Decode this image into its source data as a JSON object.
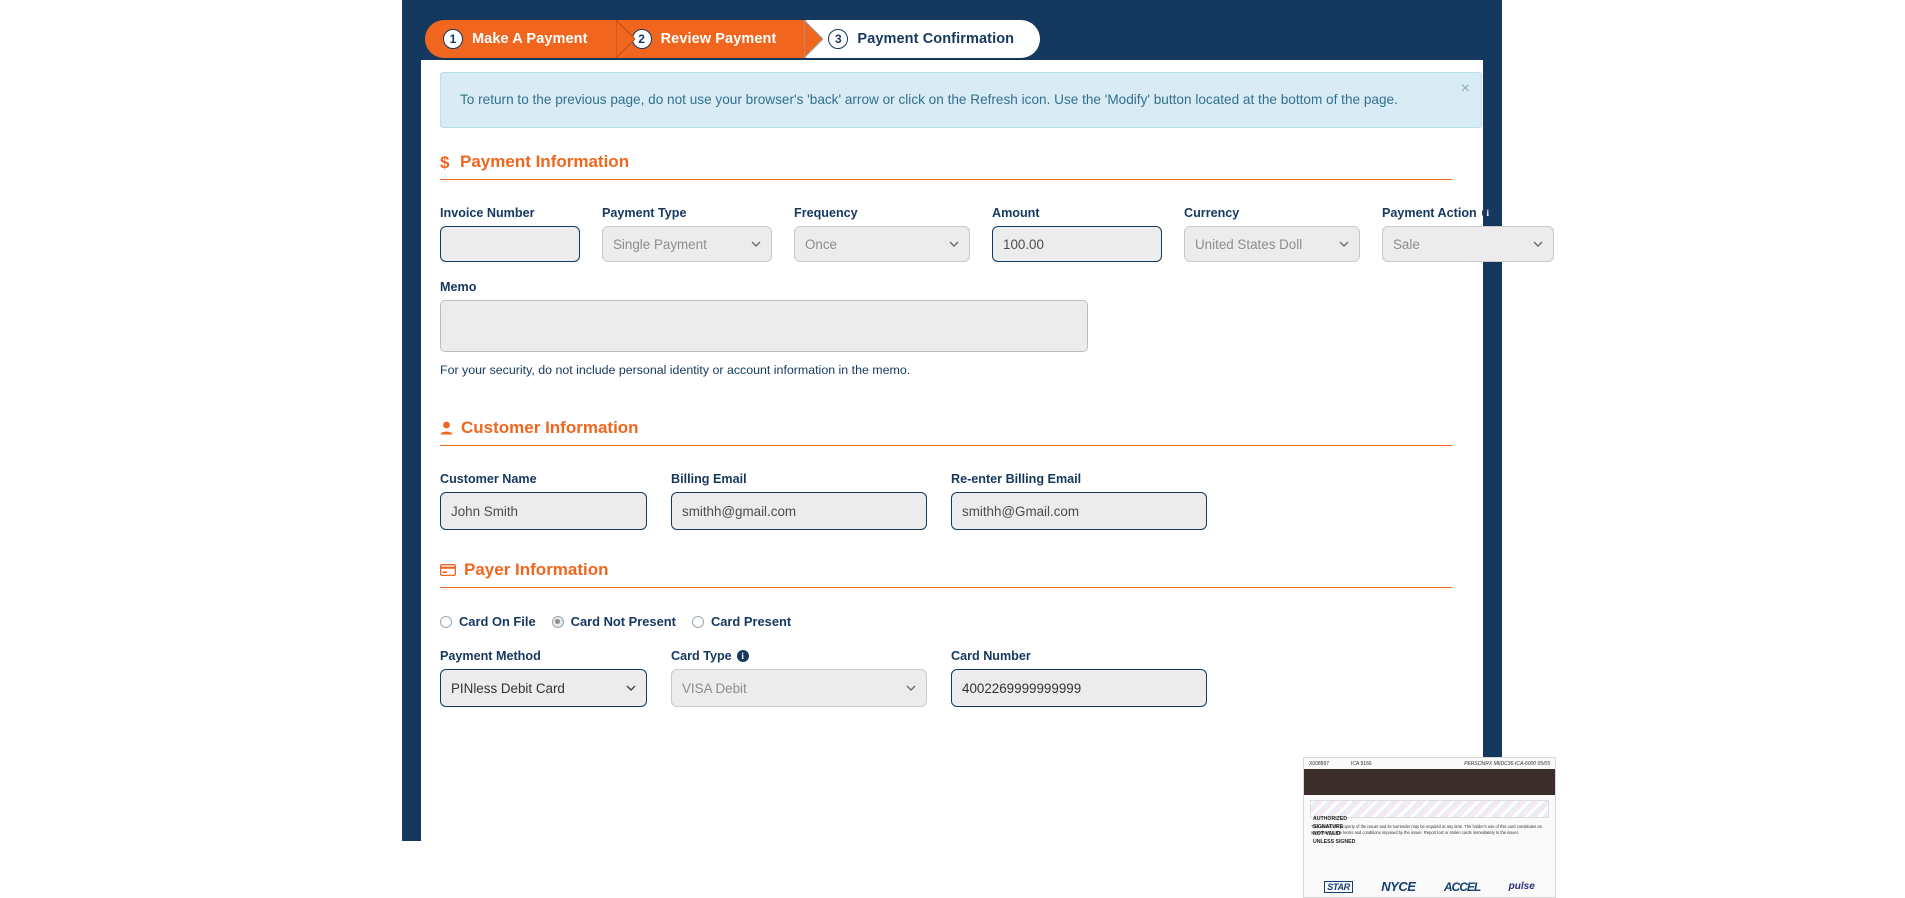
{
  "wizard": {
    "steps": [
      {
        "number": "1",
        "label": "Make A Payment",
        "state": "done"
      },
      {
        "number": "2",
        "label": "Review Payment",
        "state": "active"
      },
      {
        "number": "3",
        "label": "Payment Confirmation",
        "state": "todo"
      }
    ]
  },
  "alert": {
    "message": "To return to the previous page, do not use your browser's 'back' arrow or click on the Refresh icon. Use the 'Modify' button located at the bottom of the page.",
    "close_label": "×"
  },
  "payment_information": {
    "heading": "Payment Information",
    "heading_icon": "dollar-icon",
    "invoice_number": {
      "label": "Invoice Number",
      "value": ""
    },
    "payment_type": {
      "label": "Payment Type",
      "value": "Single Payment"
    },
    "frequency": {
      "label": "Frequency",
      "value": "Once"
    },
    "amount": {
      "label": "Amount",
      "value": "100.00"
    },
    "currency": {
      "label": "Currency",
      "value": "United States Doll"
    },
    "payment_action": {
      "label": "Payment Action",
      "value": "Sale",
      "info_icon": "info-icon"
    },
    "memo": {
      "label": "Memo",
      "value": "",
      "note": "For your security, do not include personal identity or account information in the memo."
    }
  },
  "customer_information": {
    "heading": "Customer Information",
    "heading_icon": "user-icon",
    "customer_name": {
      "label": "Customer Name",
      "value": "John Smith"
    },
    "billing_email": {
      "label": "Billing Email",
      "value": "smithh@gmail.com"
    },
    "reenter_billing_email": {
      "label": "Re-enter Billing Email",
      "value": "smithh@Gmail.com"
    }
  },
  "payer_information": {
    "heading": "Payer Information",
    "heading_icon": "credit-card-icon",
    "card_presence_options": [
      {
        "label": "Card On File",
        "selected": false
      },
      {
        "label": "Card Not Present",
        "selected": true
      },
      {
        "label": "Card Present",
        "selected": false
      }
    ],
    "payment_method": {
      "label": "Payment Method",
      "value": "PINless Debit Card"
    },
    "card_type": {
      "label": "Card Type",
      "value": "VISA Debit",
      "info_icon": "info-icon"
    },
    "card_number": {
      "label": "Card Number",
      "value": "4002269999999999"
    }
  },
  "card_image": {
    "top_left_code": "X008897",
    "top_mid_code": "ICA 9166",
    "top_right_code": "PERSONRX  MIIDC36-ICA-6000 05/05",
    "signature_lines": "AUTHORIZED\nSIGNATURE\nNOT VALID\nUNLESS SIGNED",
    "legal_text": "This card is the property of the issuer and its surrender may be required at any time. The holder's use of this card constitutes an agreement to the terms and conditions imposed by the issuer. Report lost or stolen cards immediately to the issuer.",
    "networks": [
      "STAR",
      "NYCE",
      "ACCEL",
      "pulse"
    ]
  },
  "colors": {
    "frame_navy": "#15385f",
    "accent_orange": "#f0661e",
    "alert_bg": "#d9ecf5",
    "alert_text": "#31708f",
    "field_bg": "#ececec"
  }
}
